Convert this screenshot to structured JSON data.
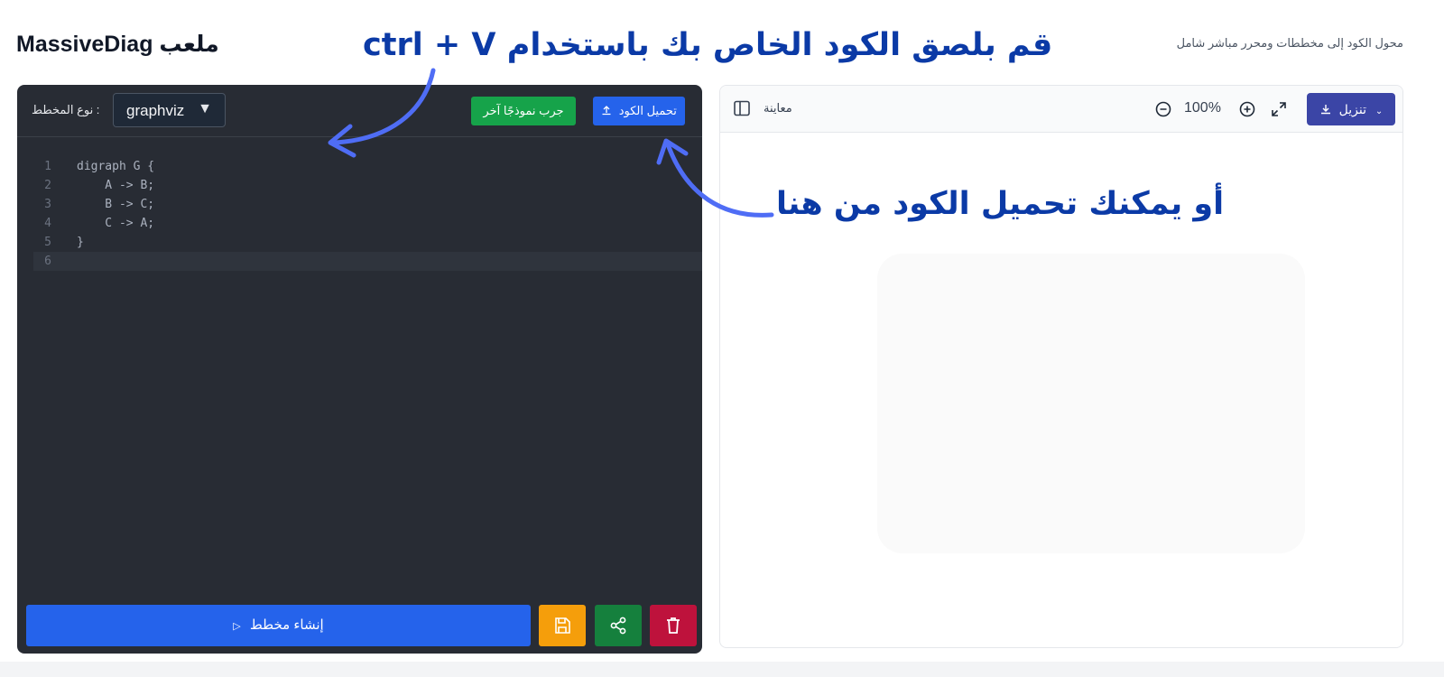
{
  "header": {
    "title": "MassiveDiag ملعب",
    "subtitle": "محول الكود إلى مخططات ومحرر مباشر شامل"
  },
  "annotations": {
    "paste_hint": "قم بلصق الكود الخاص بك باستخدام ctrl + V",
    "upload_hint": "أو يمكنك تحميل الكود من هنا",
    "color": "#0b3aa6",
    "arrow_color": "#4f6df5"
  },
  "editor": {
    "type_label": ": نوع المخطط",
    "type_value": "graphviz",
    "try_button": "جرب نموذجًا آخر",
    "upload_button": "تحميل الكود",
    "code_lines": [
      {
        "num": "1",
        "text": "digraph G {"
      },
      {
        "num": "2",
        "text": "    A -> B;"
      },
      {
        "num": "3",
        "text": "    B -> C;"
      },
      {
        "num": "4",
        "text": "    C -> A;"
      },
      {
        "num": "5",
        "text": "}"
      },
      {
        "num": "6",
        "text": ""
      }
    ],
    "active_line": 6,
    "generate_button": "إنشاء مخطط",
    "icons": [
      "upload-icon",
      "save-icon",
      "share-icon",
      "trash-icon",
      "play-icon"
    ]
  },
  "preview": {
    "label": "معاينة",
    "zoom": "100%",
    "download_button": "تنزيل",
    "icons": [
      "sidebar-toggle-icon",
      "zoom-out-icon",
      "zoom-in-icon",
      "fullscreen-icon",
      "download-icon",
      "chevron-down-icon"
    ]
  },
  "colors": {
    "editor_bg": "#282c34",
    "primary": "#2563eb",
    "green": "#16a34a",
    "amber": "#f59e0b",
    "red": "#be123c",
    "download": "#3b45a6"
  }
}
